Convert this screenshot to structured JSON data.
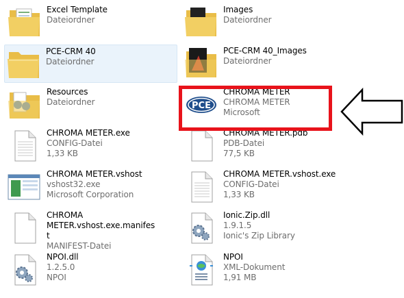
{
  "colors": {
    "folder": "#f2cf63",
    "selection": "#eaf3fb",
    "highlight": "#e8131b",
    "name_text": "#000000",
    "detail_text": "#6d6d6d"
  },
  "files": [
    {
      "name": "Excel Template",
      "lines": [
        "Dateiordner"
      ],
      "icon": "folder-with-spreadsheet-icon"
    },
    {
      "name": "Images",
      "lines": [
        "Dateiordner"
      ],
      "icon": "folder-with-images-icon"
    },
    {
      "name": "PCE-CRM 40",
      "lines": [
        "Dateiordner"
      ],
      "icon": "folder-icon",
      "selected": true
    },
    {
      "name": "PCE-CRM 40_Images",
      "lines": [
        "Dateiordner"
      ],
      "icon": "folder-with-dark-images-icon"
    },
    {
      "name": "Resources",
      "lines": [
        "Dateiordner"
      ],
      "icon": "folder-with-documents-icon"
    },
    {
      "name": "CHROMA METER",
      "lines": [
        "CHROMA METER",
        "Microsoft"
      ],
      "icon": "pce-logo-icon"
    },
    {
      "name": "CHROMA METER.exe",
      "lines": [
        "CONFIG-Datei",
        "1,33 KB"
      ],
      "icon": "generic-file-icon"
    },
    {
      "name": "CHROMA METER.pdb",
      "lines": [
        "PDB-Datei",
        "77,5 KB"
      ],
      "icon": "generic-file-icon"
    },
    {
      "name": "CHROMA METER.vshost",
      "lines": [
        "vshost32.exe",
        "Microsoft Corporation"
      ],
      "icon": "application-window-icon"
    },
    {
      "name": "CHROMA METER.vshost.exe",
      "lines": [
        "CONFIG-Datei",
        "1,33 KB"
      ],
      "icon": "generic-file-icon"
    },
    {
      "name": "CHROMA METER.vshost.exe.manifest",
      "lines": [
        "MANIFEST-Datei"
      ],
      "icon": "blank-file-icon"
    },
    {
      "name": "Ionic.Zip.dll",
      "lines": [
        "1.9.1.5",
        "Ionic's Zip Library"
      ],
      "icon": "dll-gear-icon"
    },
    {
      "name": "NPOI.dll",
      "lines": [
        "1.2.5.0",
        "NPOI"
      ],
      "icon": "dll-gear-icon"
    },
    {
      "name": "NPOI",
      "lines": [
        "XML-Dokument",
        "1,91 MB"
      ],
      "icon": "xml-document-icon"
    }
  ]
}
